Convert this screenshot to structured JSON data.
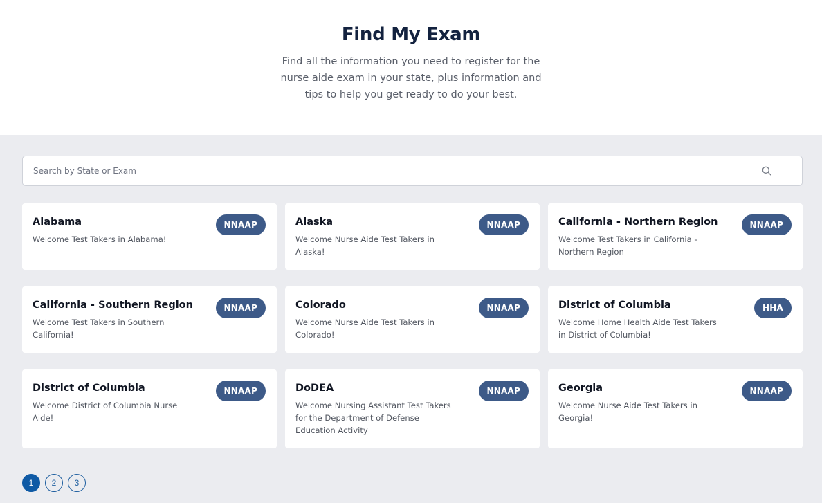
{
  "header": {
    "title": "Find My Exam",
    "subtitle": "Find all the information you need to register for the nurse aide exam in your state, plus information and tips to help you get ready to do your best."
  },
  "search": {
    "placeholder": "Search by State or Exam",
    "value": "",
    "icon": "search-icon"
  },
  "cards": [
    {
      "title": "Alabama",
      "description": "Welcome Test Takers in Alabama!",
      "badge": "NNAAP"
    },
    {
      "title": "Alaska",
      "description": "Welcome Nurse Aide Test Takers in Alaska!",
      "badge": "NNAAP"
    },
    {
      "title": "California - Northern Region",
      "description": "Welcome Test Takers in California - Northern Region",
      "badge": "NNAAP"
    },
    {
      "title": "California - Southern Region",
      "description": "Welcome Test Takers in Southern California!",
      "badge": "NNAAP"
    },
    {
      "title": "Colorado",
      "description": "Welcome Nurse Aide Test Takers in Colorado!",
      "badge": "NNAAP"
    },
    {
      "title": "District of Columbia",
      "description": "Welcome Home Health Aide Test Takers in District of Columbia!",
      "badge": "HHA"
    },
    {
      "title": "District of Columbia",
      "description": "Welcome District of Columbia Nurse Aide!",
      "badge": "NNAAP"
    },
    {
      "title": "DoDEA",
      "description": "Welcome Nursing Assistant Test Takers for the Department of Defense Education Activity",
      "badge": "NNAAP"
    },
    {
      "title": "Georgia",
      "description": "Welcome Nurse Aide Test Takers in Georgia!",
      "badge": "NNAAP"
    }
  ],
  "pagination": {
    "pages": [
      "1",
      "2",
      "3"
    ],
    "current": "1"
  },
  "colors": {
    "badge": "#3d5a88",
    "page_active": "#0f5aa5",
    "background": "#ebecf0",
    "title": "#13223f"
  }
}
